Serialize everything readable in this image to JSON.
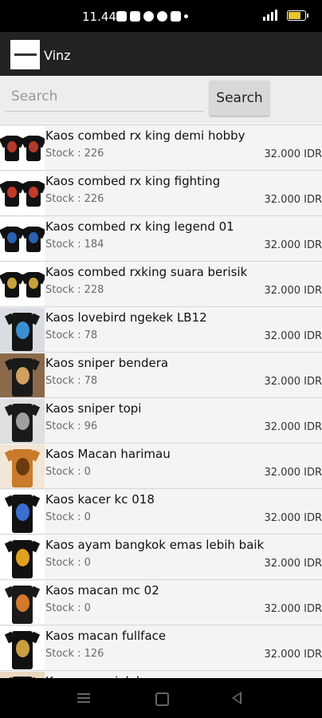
{
  "status_bar": {
    "time": "11.44",
    "battery_color": "#e9c530"
  },
  "app_bar": {
    "title": "Vinz"
  },
  "search": {
    "placeholder": "Search",
    "value": "",
    "button_label": "Search"
  },
  "products": [
    {
      "name": "Kaos combed rx king demi hobby",
      "stock": "Stock : 226",
      "price": "32.000 IDR",
      "shirt_color": "#111111",
      "print_color": "#b33a2a",
      "bg": "#ffffff",
      "pair": true
    },
    {
      "name": "Kaos combed rx king fighting",
      "stock": "Stock : 226",
      "price": "32.000 IDR",
      "shirt_color": "#111111",
      "print_color": "#c23a2a",
      "bg": "#ffffff",
      "pair": true
    },
    {
      "name": "Kaos combed rx king legend 01",
      "stock": "Stock : 184",
      "price": "32.000 IDR",
      "shirt_color": "#111111",
      "print_color": "#2a5fb3",
      "bg": "#ffffff",
      "pair": true
    },
    {
      "name": "Kaos combed rxking suara berisik",
      "stock": "Stock : 228",
      "price": "32.000 IDR",
      "shirt_color": "#111111",
      "print_color": "#c9a23a",
      "bg": "#ffffff",
      "pair": true
    },
    {
      "name": "Kaos lovebird ngekek LB12",
      "stock": "Stock : 78",
      "price": "32.000 IDR",
      "shirt_color": "#151515",
      "print_color": "#3a8fd0",
      "bg": "#d9dde3",
      "pair": false
    },
    {
      "name": "Kaos sniper bendera",
      "stock": "Stock : 78",
      "price": "32.000 IDR",
      "shirt_color": "#1a1a1a",
      "print_color": "#d0a060",
      "bg": "#8a6a4a",
      "pair": false
    },
    {
      "name": "Kaos sniper topi",
      "stock": "Stock : 96",
      "price": "32.000 IDR",
      "shirt_color": "#1a1a1a",
      "print_color": "#a0a0a0",
      "bg": "#e0e0e0",
      "pair": false
    },
    {
      "name": "Kaos Macan harimau",
      "stock": "Stock : 0",
      "price": "32.000 IDR",
      "shirt_color": "#c97a2a",
      "print_color": "#6a3a10",
      "bg": "#f2e6d6",
      "pair": false
    },
    {
      "name": "Kaos kacer kc 018",
      "stock": "Stock : 0",
      "price": "32.000 IDR",
      "shirt_color": "#111111",
      "print_color": "#3a6fd0",
      "bg": "#ffffff",
      "pair": false
    },
    {
      "name": "Kaos ayam bangkok emas lebih baik",
      "stock": "Stock : 0",
      "price": "32.000 IDR",
      "shirt_color": "#111111",
      "print_color": "#e0a020",
      "bg": "#ffffff",
      "pair": false
    },
    {
      "name": "Kaos macan mc 02",
      "stock": "Stock : 0",
      "price": "32.000 IDR",
      "shirt_color": "#1a1a1a",
      "print_color": "#d07a2a",
      "bg": "#ffffff",
      "pair": false
    },
    {
      "name": "Kaos macan fullface",
      "stock": "Stock : 126",
      "price": "32.000 IDR",
      "shirt_color": "#111111",
      "print_color": "#c9a040",
      "bg": "#ffffff",
      "pair": false
    },
    {
      "name": "Kaos ayam jalak",
      "stock": "",
      "price": "",
      "shirt_color": "#1a1a1a",
      "print_color": "#c07030",
      "bg": "#e8d8c0",
      "pair": false
    }
  ]
}
